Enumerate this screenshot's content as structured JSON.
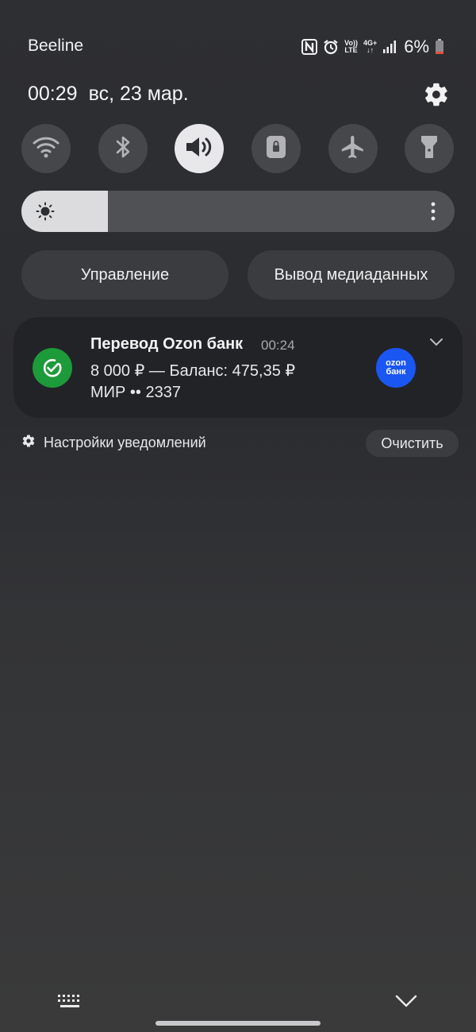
{
  "status_bar": {
    "carrier": "Beeline",
    "icons": [
      "nfc-icon",
      "alarm-icon",
      "volte-icon",
      "4g-plus-icon",
      "signal-icon",
      "battery-icon"
    ],
    "volte_top": "Vo))",
    "volte_bottom": "LTE",
    "network_top": "4G+",
    "network_bottom": "↓↑",
    "battery_percent": "6%",
    "battery_level": 0.06,
    "battery_low_color": "#e0523c"
  },
  "header": {
    "time": "00:29",
    "date": "вс, 23 мар."
  },
  "quick_tiles": [
    {
      "name": "wifi",
      "icon": "wifi-icon",
      "active": false
    },
    {
      "name": "bluetooth",
      "icon": "bluetooth-icon",
      "active": false
    },
    {
      "name": "sound",
      "icon": "speaker-icon",
      "active": true
    },
    {
      "name": "rotation-lock",
      "icon": "lock-icon",
      "active": false
    },
    {
      "name": "airplane",
      "icon": "airplane-icon",
      "active": false
    },
    {
      "name": "flashlight",
      "icon": "flashlight-icon",
      "active": false
    }
  ],
  "brightness": {
    "level": 0.2
  },
  "buttons": {
    "device_control": "Управление",
    "media_output": "Вывод медиаданных"
  },
  "notification": {
    "title": "Перевод Ozon банк",
    "time": "00:24",
    "line1": "8 000 ₽ — Баланс: 475,35 ₽",
    "line2": "МИР •• 2337",
    "app_logo_top": "ozon",
    "app_logo_bottom": "банк",
    "icon_color": "#1d9a3a",
    "logo_color": "#1a56f2"
  },
  "notification_settings_label": "Настройки уведомлений",
  "clear_label": "Очистить"
}
